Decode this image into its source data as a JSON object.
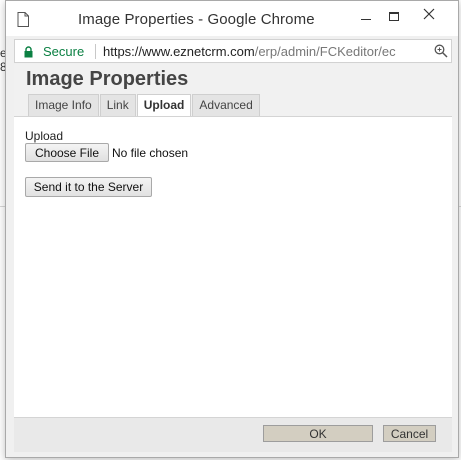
{
  "background": {
    "left_text": "e 8"
  },
  "window": {
    "title": "Image Properties - Google Chrome",
    "controls": {
      "minimize": "minimize-icon",
      "maximize": "maximize-icon",
      "close": "close-icon"
    }
  },
  "addressbar": {
    "secure_label": "Secure",
    "url_main": "https://www.eznetcrm.com",
    "url_path": "/erp/admin/FCKeditor/ec",
    "zoom_icon": "zoom-icon"
  },
  "dialog": {
    "title": "Image Properties",
    "tabs": [
      {
        "label": "Image Info",
        "active": false
      },
      {
        "label": "Link",
        "active": false
      },
      {
        "label": "Upload",
        "active": true
      },
      {
        "label": "Advanced",
        "active": false
      }
    ],
    "upload": {
      "label": "Upload",
      "choose_button": "Choose File",
      "file_status": "No file chosen",
      "send_button": "Send it to the Server"
    },
    "footer": {
      "ok_label": "OK",
      "cancel_label": "Cancel"
    }
  },
  "colors": {
    "secure": "#0b8043",
    "footer_button": "#d3cec1",
    "dialog_bg": "#f1f1f1"
  }
}
